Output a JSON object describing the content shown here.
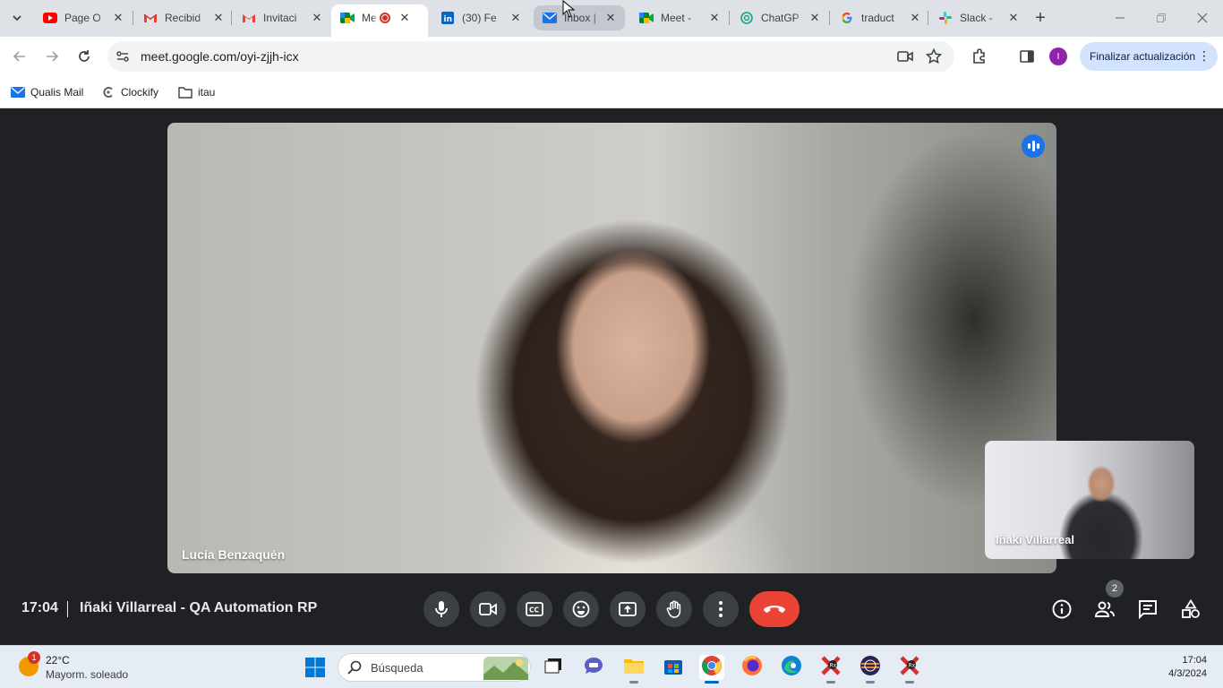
{
  "browser": {
    "tabs": [
      {
        "title": "Page O",
        "icon": "youtube-icon"
      },
      {
        "title": "Recibid",
        "icon": "gmail-icon"
      },
      {
        "title": "Invitaci",
        "icon": "gmail-icon"
      },
      {
        "title": "Me",
        "icon": "meet-icon",
        "active": true,
        "recording": true
      },
      {
        "title": "(30) Fe",
        "icon": "linkedin-icon"
      },
      {
        "title": "Inbox |",
        "icon": "mail-icon",
        "hovered": true
      },
      {
        "title": "Meet -",
        "icon": "meet-icon"
      },
      {
        "title": "ChatGP",
        "icon": "chatgpt-icon"
      },
      {
        "title": "traduct",
        "icon": "google-icon"
      },
      {
        "title": "Slack -",
        "icon": "slack-icon"
      }
    ],
    "url": "meet.google.com/oyi-zjjh-icx",
    "update_button": "Finalizar actualización",
    "profile_initial": "I",
    "bookmarks": [
      {
        "label": "Qualis Mail",
        "icon": "mail-icon"
      },
      {
        "label": "Clockify",
        "icon": "clockify-icon"
      },
      {
        "label": "itau",
        "icon": "folder-icon"
      }
    ]
  },
  "meet": {
    "main_participant": "Lucía Benzaquén",
    "self_participant": "Iñaki Villarreal",
    "time": "17:04",
    "meeting_title": "Iñaki Villarreal - QA Automation RP",
    "participant_count": "2"
  },
  "taskbar": {
    "weather_badge": "1",
    "temperature": "22°C",
    "condition": "Mayorm. soleado",
    "search_placeholder": "Búsqueda",
    "clock_time": "17:04",
    "clock_date": "4/3/2024"
  },
  "colors": {
    "meet_bg": "#202124",
    "end_call": "#ea4335",
    "accent": "#1a73e8"
  }
}
